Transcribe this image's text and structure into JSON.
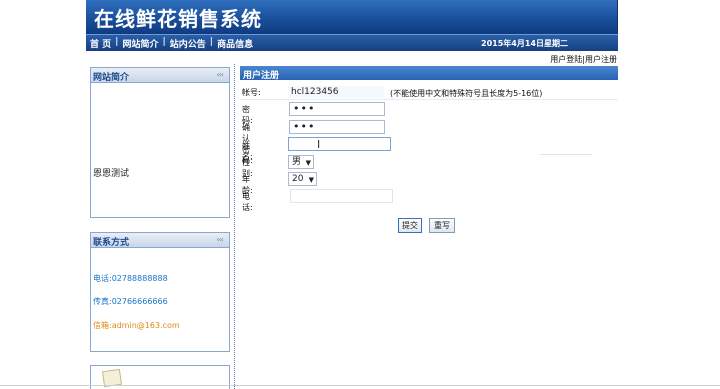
{
  "header": {
    "title": "在线鲜花销售系统",
    "nav": [
      "首 页",
      "网站简介",
      "站内公告",
      "商品信息"
    ],
    "date": "2015年4月14日星期二"
  },
  "user_links": {
    "login": "用户登陆",
    "separator": "|",
    "register": "用户注册"
  },
  "sidebar": {
    "intro": {
      "title": "网站简介",
      "arrows": "‹‹‹",
      "body": "恩恩测试"
    },
    "contact": {
      "title": "联系方式",
      "arrows": "‹‹‹",
      "phone": "电话:02788888888",
      "fax": "传真:02766666666",
      "email": "信箱:admin@163.com"
    }
  },
  "form": {
    "title": "用户注册",
    "account_label": "帐号:",
    "account_value": "hcl123456",
    "account_hint": "(不能使用中文和特殊符号且长度为5-16位)",
    "password_label": "密码:",
    "password_value": "•••",
    "confirm_label": "确认密码:",
    "confirm_value": "•••",
    "name_label": "姓名:",
    "name_value": "",
    "gender_label": "性别:",
    "gender_value": "男",
    "age_label": "年龄:",
    "age_value": "20",
    "phone_label": "电话:",
    "phone_value": "",
    "submit_label": "提交",
    "reset_label": "重写"
  }
}
